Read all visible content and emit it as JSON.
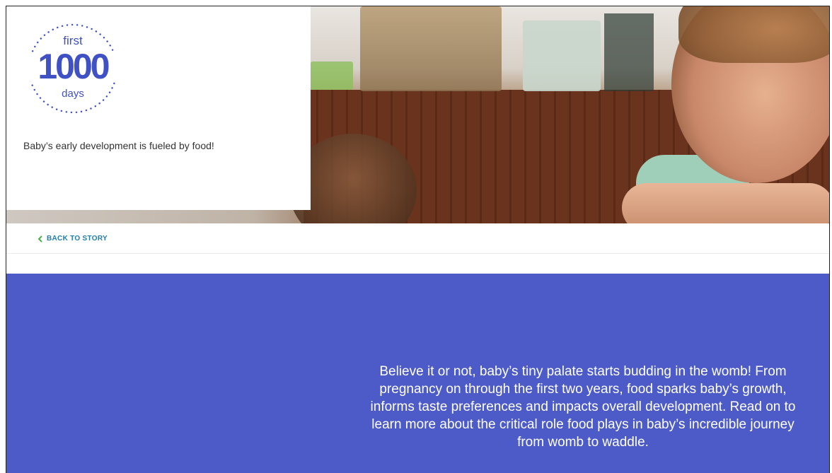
{
  "logo": {
    "top_text": "first",
    "number": "1000",
    "bottom_text": "days",
    "color": "#3f51c4"
  },
  "hero": {
    "tagline": "Baby’s early development is fueled by food!"
  },
  "nav": {
    "back_label": "BACK TO STORY",
    "back_icon": "chevron-left-icon",
    "chevron_color": "#4caf50",
    "link_color": "#1f7fa8"
  },
  "intro": {
    "text": "Believe it or not, baby’s tiny palate starts budding in the womb! From pregnancy on through the first two years, food sparks baby’s growth, informs taste preferences and impacts overall development. Read on to learn more about the critical role food plays in baby’s incredible journey from womb to waddle.",
    "background": "#4c5bc8"
  }
}
